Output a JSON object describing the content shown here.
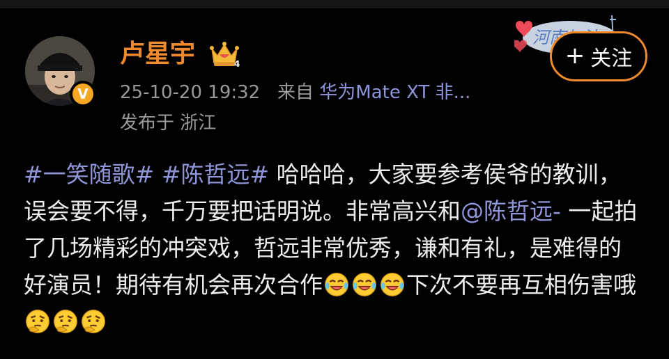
{
  "colors": {
    "accent": "#f08a2c",
    "link": "#8e95d8",
    "meta_text": "#9a9a9a",
    "body_text": "#ececec",
    "background": "#000000"
  },
  "author": {
    "name": "卢星宇",
    "badge_level": "4",
    "verified_icon": "verified-v-icon"
  },
  "meta": {
    "timestamp": "25-10-20 19:32",
    "from_label": "来自",
    "device": "华为Mate XT 非...",
    "location": "发布于 浙江"
  },
  "sticker": {
    "text": "河南加油"
  },
  "follow_button": {
    "plus": "+",
    "label": "关注"
  },
  "post": {
    "hashtag1": "#一笑随歌#",
    "hashtag2": "#陈哲远#",
    "text1": " 哈哈哈，大家要参考侯爷的教训，误会要不得，千万要把话明说。非常高兴和",
    "mention": "@陈哲远-",
    "text2": " 一起拍了几场精彩的冲突戏，哲远非常优秀，谦和有礼，是难得的好演员！期待有机会再次合作",
    "text3": "下次不要再互相伤害哦",
    "emoji_group1": [
      "laughing-tears-emoji",
      "laughing-tears-emoji",
      "laughing-tears-emoji"
    ],
    "emoji_group2": [
      "thinking-emoji",
      "thinking-emoji",
      "thinking-emoji"
    ]
  }
}
